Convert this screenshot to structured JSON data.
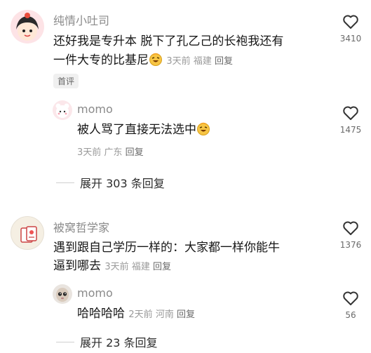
{
  "comments": [
    {
      "user": "纯情小吐司",
      "line1": "还好我是专升本 脱下了孔乙己的长袍我还有",
      "line2": "一件大专的比基尼",
      "time": "3天前",
      "location": "福建",
      "reply_label": "回复",
      "badge": "首评",
      "likes": "3410",
      "replies": [
        {
          "user": "momo",
          "text": "被人骂了直接无法选中",
          "time": "3天前",
          "location": "广东",
          "reply_label": "回复",
          "likes": "1475"
        }
      ],
      "expand_label": "展开 303 条回复"
    },
    {
      "user": "被窝哲学家",
      "line1": "遇到跟自己学历一样的：大家都一样你能牛",
      "line2": "逼到哪去",
      "time": "3天前",
      "location": "福建",
      "reply_label": "回复",
      "likes": "1376",
      "replies": [
        {
          "user": "momo",
          "text": "哈哈哈哈",
          "time": "2天前",
          "location": "河南",
          "reply_label": "回复",
          "likes": "56"
        }
      ],
      "expand_label": "展开 23 条回复"
    }
  ],
  "colors": {
    "name": "#8a8a8a",
    "text": "#161616",
    "meta": "#9a9a9a"
  }
}
